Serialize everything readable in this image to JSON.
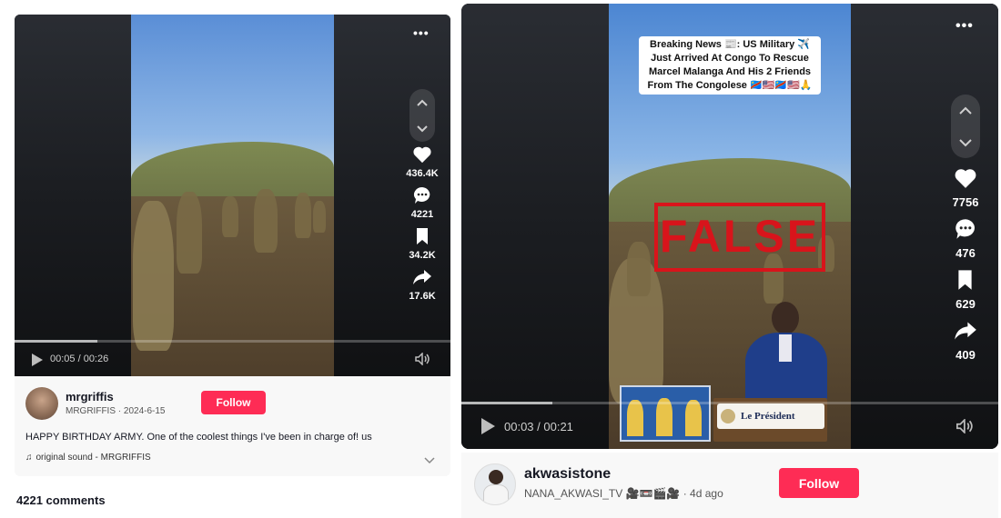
{
  "left_post": {
    "more_icon": "•••",
    "actions": [
      {
        "icon": "heart-icon",
        "count": "436.4K"
      },
      {
        "icon": "comment-icon",
        "count": "4221"
      },
      {
        "icon": "bookmark-icon",
        "count": "34.2K"
      },
      {
        "icon": "share-icon",
        "count": "17.6K"
      }
    ],
    "time": "00:05 / 00:26",
    "progress": 0.19,
    "username": "mrgriffis",
    "handle_date": "MRGRIFFIS · 2024-6-15",
    "follow_label": "Follow",
    "caption": "HAPPY BIRTHDAY ARMY. One of the coolest things I've been in charge of! us",
    "sound": "original sound - MRGRIFFIS",
    "comments": "4221 comments"
  },
  "right_post": {
    "more_icon": "•••",
    "news_text": "Breaking News 📰: US Military ✈️ Just Arrived At Congo To Rescue Marcel Malanga And His 2 Friends From The Congolese 🇨🇩🇺🇸🇨🇩🇺🇸🙏",
    "stamp": "FALSE",
    "podium_label": "Le Président",
    "actions": [
      {
        "icon": "heart-icon",
        "count": "7756"
      },
      {
        "icon": "comment-icon",
        "count": "476"
      },
      {
        "icon": "bookmark-icon",
        "count": "629"
      },
      {
        "icon": "share-icon",
        "count": "409"
      }
    ],
    "time": "00:03 / 00:21",
    "progress": 0.17,
    "username": "akwasistone",
    "handle": "NANA_AKWASI_TV 🎥📼🎬🎥",
    "date": "· 4d ago",
    "follow_label": "Follow"
  },
  "colors": {
    "follow": "#fe2c55",
    "false_red": "#d8141b"
  }
}
